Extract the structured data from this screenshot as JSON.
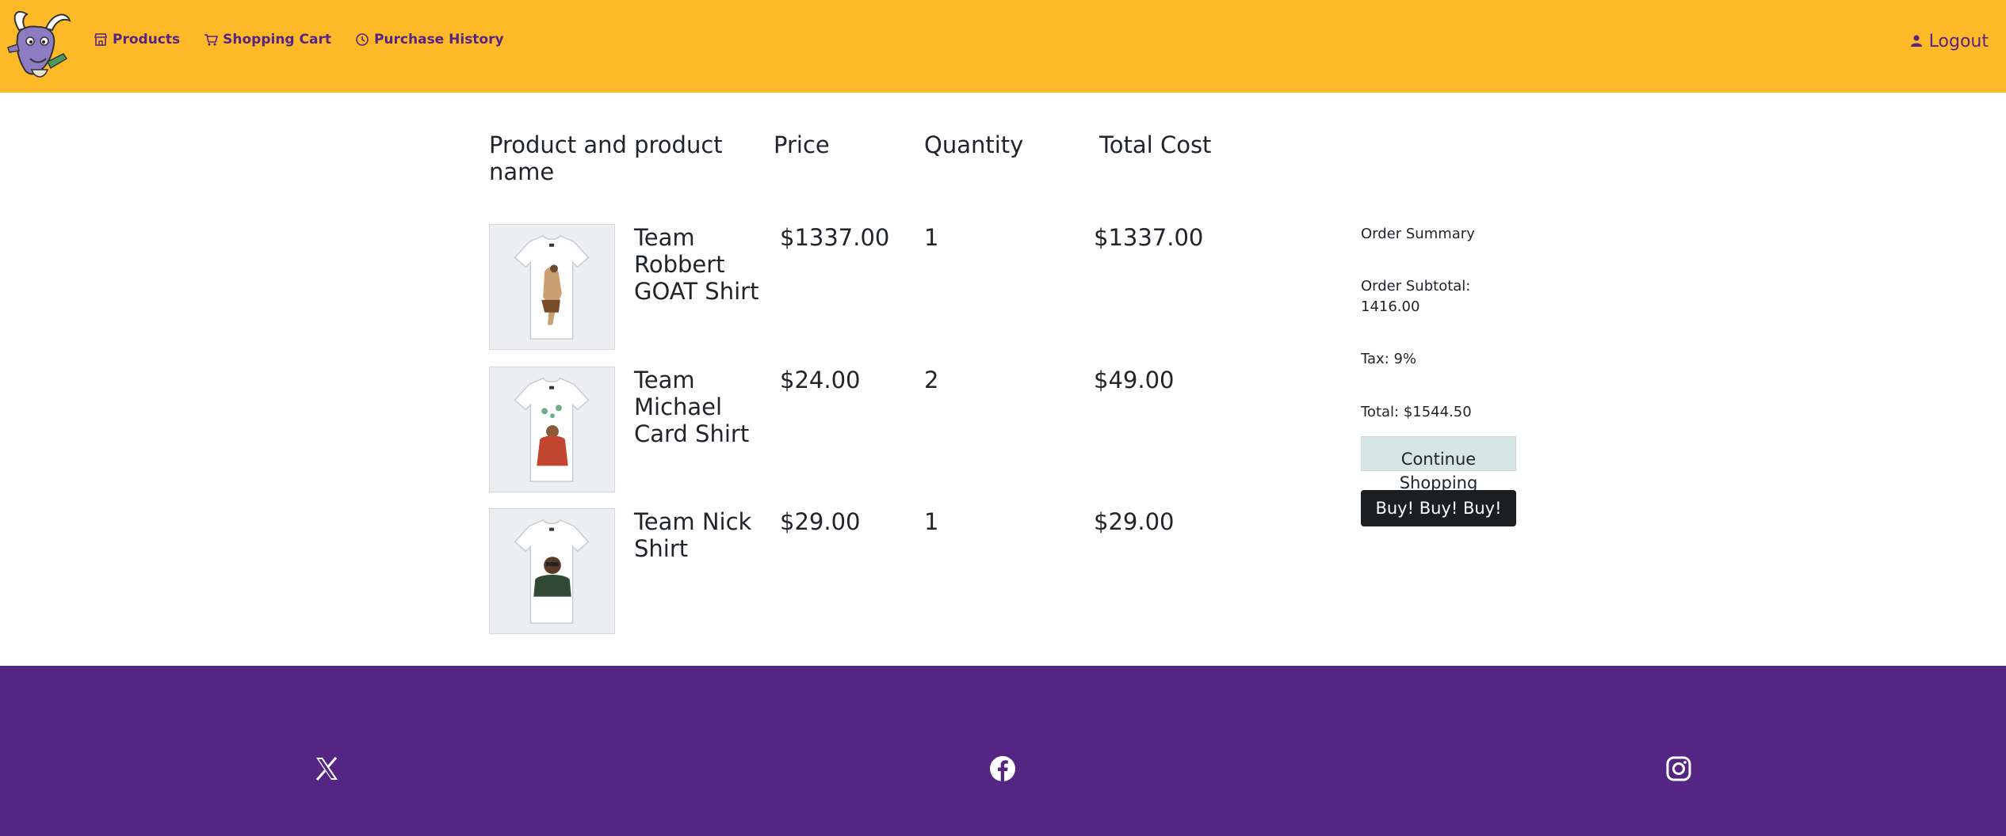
{
  "navbar": {
    "items": [
      {
        "label": "Products",
        "icon": "store-icon"
      },
      {
        "label": "Shopping Cart",
        "icon": "cart-icon"
      },
      {
        "label": "Purchase History",
        "icon": "clock-icon"
      }
    ],
    "logout_label": "Logout",
    "logout_icon": "user-icon"
  },
  "table": {
    "headers": [
      "Product and product name",
      "Price",
      "Quantity",
      "Total Cost"
    ],
    "rows": [
      {
        "name": "Team Robbert GOAT Shirt",
        "price": "$1337.00",
        "quantity": "1",
        "total": "$1337.00"
      },
      {
        "name": "Team Michael Card Shirt",
        "price": "$24.00",
        "quantity": "2",
        "total": "$49.00"
      },
      {
        "name": "Team Nick Shirt",
        "price": "$29.00",
        "quantity": "1",
        "total": "$29.00"
      }
    ]
  },
  "summary": {
    "title": "Order Summary",
    "subtotal": "Order Subtotal: 1416.00",
    "tax": "Tax: 9%",
    "total": "Total: $1544.50",
    "continue_label": "Continue Shopping",
    "buy_label": "Buy! Buy! Buy!"
  },
  "footer": {
    "icons": [
      "x-icon",
      "facebook-icon",
      "instagram-icon"
    ]
  },
  "colors": {
    "header_bg": "#fdb927",
    "brand_purple": "#542582",
    "buy_button": "#1c1f22",
    "continue_button": "#d5e6e5"
  }
}
